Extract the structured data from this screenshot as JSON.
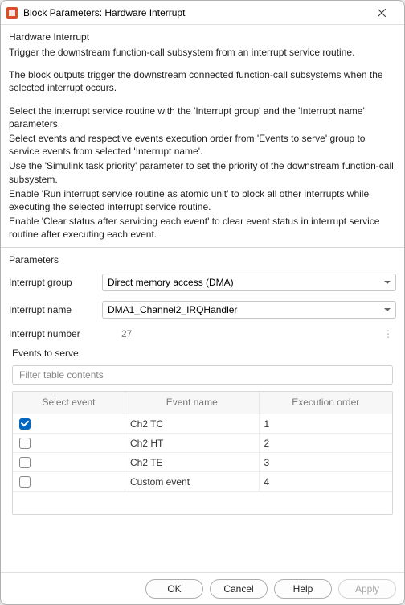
{
  "window": {
    "title": "Block Parameters: Hardware Interrupt"
  },
  "header": {
    "title": "Hardware Interrupt"
  },
  "description": {
    "p1": "Trigger the downstream function-call subsystem from an interrupt service routine.",
    "p2": "The block outputs trigger the downstream connected function-call subsystems when the selected interrupt occurs.",
    "p3": "Select the interrupt service routine with the 'Interrupt group' and the 'Interrupt name' parameters.",
    "p4": "Select events and respective events execution order from 'Events to serve' group to service events from selected 'Interrupt name'.",
    "p5": "Use the 'Simulink task priority' parameter to set the priority of the downstream function-call subsystem.",
    "p6": "Enable 'Run interrupt service routine as atomic unit' to block all other interrupts while executing the selected interrupt service routine.",
    "p7": "Enable 'Clear status after servicing each event' to clear event status in interrupt service routine after executing each event."
  },
  "parameters": {
    "section_label": "Parameters",
    "interrupt_group": {
      "label": "Interrupt group",
      "value": "Direct memory access (DMA)"
    },
    "interrupt_name": {
      "label": "Interrupt name",
      "value": "DMA1_Channel2_IRQHandler"
    },
    "interrupt_number": {
      "label": "Interrupt number",
      "value": "27"
    }
  },
  "events": {
    "group_label": "Events to serve",
    "filter_placeholder": "Filter table contents",
    "columns": {
      "select": "Select event",
      "name": "Event name",
      "order": "Execution order"
    },
    "rows": [
      {
        "checked": true,
        "name": "Ch2 TC",
        "order": "1"
      },
      {
        "checked": false,
        "name": "Ch2 HT",
        "order": "2"
      },
      {
        "checked": false,
        "name": "Ch2 TE",
        "order": "3"
      },
      {
        "checked": false,
        "name": "Custom event",
        "order": "4"
      }
    ]
  },
  "footer": {
    "ok": "OK",
    "cancel": "Cancel",
    "help": "Help",
    "apply": "Apply"
  }
}
